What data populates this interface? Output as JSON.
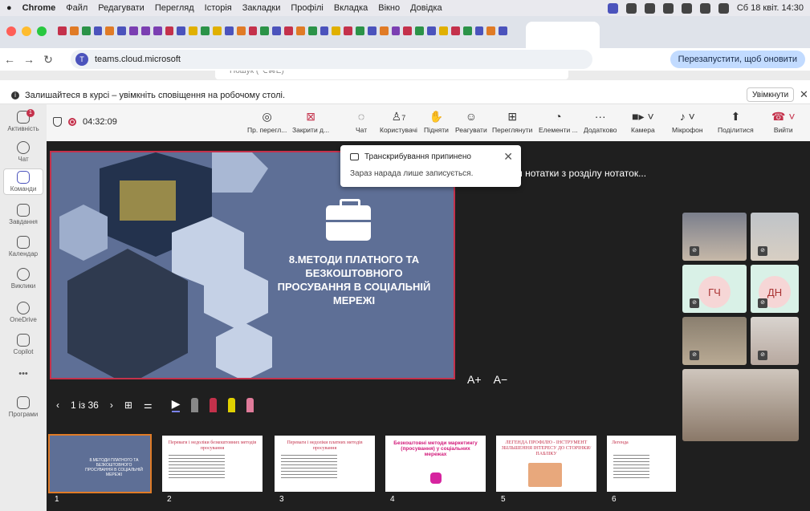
{
  "macos_menu": {
    "app": "Chrome",
    "items": [
      "Файл",
      "Редагувати",
      "Перегляд",
      "Історія",
      "Закладки",
      "Профілі",
      "Вкладка",
      "Вікно",
      "Довідка"
    ],
    "clock": "Сб 18 квіт. 14:30"
  },
  "browser": {
    "url": "teams.cloud.microsoft",
    "relaunch_label": "Перезапустити, щоб оновити",
    "teams_search_placeholder": "Пошук (⌥⌘E)"
  },
  "notification": {
    "text": "Залишайтеся в курсі – увімкніть сповіщення на робочому столі.",
    "enable_label": "Увімкнути",
    "close_glyph": "✕"
  },
  "rail": {
    "items": [
      {
        "label": "Активність",
        "icon": "bell-icon",
        "badge": "1"
      },
      {
        "label": "Чат",
        "icon": "chat-icon"
      },
      {
        "label": "Команди",
        "icon": "teams-icon"
      },
      {
        "label": "Завдання",
        "icon": "tasks-icon"
      },
      {
        "label": "Календар",
        "icon": "calendar-icon"
      },
      {
        "label": "Виклики",
        "icon": "phone-icon"
      },
      {
        "label": "OneDrive",
        "icon": "cloud-icon"
      },
      {
        "label": "Copilot",
        "icon": "copilot-icon"
      },
      {
        "label": "Програми",
        "icon": "apps-icon"
      }
    ],
    "more": "•••"
  },
  "meeting": {
    "timer": "04:32:09",
    "controls": {
      "view": "Пр. перегл...",
      "close": "Закрити д...",
      "chat": "Чат",
      "people": "Користувачі",
      "people_count": "7",
      "raise": "Підняти",
      "react": "Реагувати",
      "review": "Переглянути",
      "elements": "Елементи ...",
      "more": "Додатково",
      "camera": "Камера",
      "mic": "Мікрофон",
      "share": "Поділитися",
      "leave": "Вийти"
    }
  },
  "toast": {
    "title": "Транскрибування припинено",
    "body": "Зараз нарада лише записується."
  },
  "slide": {
    "title": "8.МЕТОДИ ПЛАТНОГО ТА БЕЗКОШТОВНОГО ПРОСУВАННЯ В СОЦІАЛЬНІЙ МЕРЕЖІ",
    "notes": "...катимуться нотатки з розділу нотаток...",
    "font_up": "A+",
    "font_down": "A−"
  },
  "pager": {
    "current": "1 із 36"
  },
  "thumbnails": [
    {
      "num": "1",
      "title": "8.МЕТОДИ ПЛАТНОГО ТА БЕЗКОШТОВНОГО ПРОСУВАННЯ В СОЦІАЛЬНІЙ МЕРЕЖІ"
    },
    {
      "num": "2",
      "title": "Переваги і недоліки безкоштовних методів просування"
    },
    {
      "num": "3",
      "title": "Переваги і недоліки платних методів просування"
    },
    {
      "num": "4",
      "title": "Безкоштовні методи маркетингу (просування) у соціальних мережах"
    },
    {
      "num": "5",
      "title": "ЛЕГЕНДА ПРОФІЛЮ - ІНСТРУМЕНТ ЗБІЛЬШЕННЯ ІНТЕРЕСУ ДО СТОРІНКИ/ПАБЛІКУ"
    },
    {
      "num": "6",
      "title": "Легенда"
    }
  ],
  "participants": [
    {
      "initials": "ГЧ"
    },
    {
      "initials": "ДН"
    }
  ]
}
